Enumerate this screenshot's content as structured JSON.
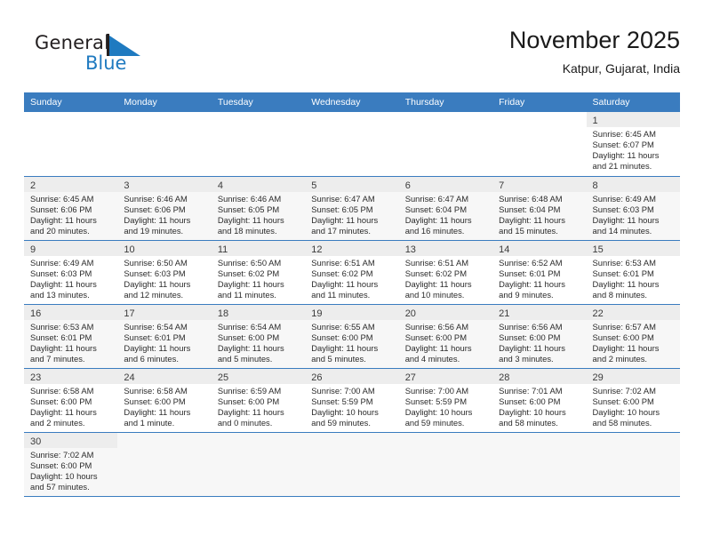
{
  "logo": {
    "word_dark": "General",
    "word_blue": "Blue",
    "flag_icon": "blue-triangle-flag-icon",
    "blue": "#1f7ac0"
  },
  "header": {
    "title": "November 2025",
    "subtitle": "Katpur, Gujarat, India"
  },
  "calendar": {
    "accent": "#3a7cbf",
    "weekdays": [
      "Sunday",
      "Monday",
      "Tuesday",
      "Wednesday",
      "Thursday",
      "Friday",
      "Saturday"
    ],
    "weeks": [
      [
        {
          "day": "",
          "lines": []
        },
        {
          "day": "",
          "lines": []
        },
        {
          "day": "",
          "lines": []
        },
        {
          "day": "",
          "lines": []
        },
        {
          "day": "",
          "lines": []
        },
        {
          "day": "",
          "lines": []
        },
        {
          "day": "1",
          "lines": [
            "Sunrise: 6:45 AM",
            "Sunset: 6:07 PM",
            "Daylight: 11 hours",
            "and 21 minutes."
          ]
        }
      ],
      [
        {
          "day": "2",
          "lines": [
            "Sunrise: 6:45 AM",
            "Sunset: 6:06 PM",
            "Daylight: 11 hours",
            "and 20 minutes."
          ]
        },
        {
          "day": "3",
          "lines": [
            "Sunrise: 6:46 AM",
            "Sunset: 6:06 PM",
            "Daylight: 11 hours",
            "and 19 minutes."
          ]
        },
        {
          "day": "4",
          "lines": [
            "Sunrise: 6:46 AM",
            "Sunset: 6:05 PM",
            "Daylight: 11 hours",
            "and 18 minutes."
          ]
        },
        {
          "day": "5",
          "lines": [
            "Sunrise: 6:47 AM",
            "Sunset: 6:05 PM",
            "Daylight: 11 hours",
            "and 17 minutes."
          ]
        },
        {
          "day": "6",
          "lines": [
            "Sunrise: 6:47 AM",
            "Sunset: 6:04 PM",
            "Daylight: 11 hours",
            "and 16 minutes."
          ]
        },
        {
          "day": "7",
          "lines": [
            "Sunrise: 6:48 AM",
            "Sunset: 6:04 PM",
            "Daylight: 11 hours",
            "and 15 minutes."
          ]
        },
        {
          "day": "8",
          "lines": [
            "Sunrise: 6:49 AM",
            "Sunset: 6:03 PM",
            "Daylight: 11 hours",
            "and 14 minutes."
          ]
        }
      ],
      [
        {
          "day": "9",
          "lines": [
            "Sunrise: 6:49 AM",
            "Sunset: 6:03 PM",
            "Daylight: 11 hours",
            "and 13 minutes."
          ]
        },
        {
          "day": "10",
          "lines": [
            "Sunrise: 6:50 AM",
            "Sunset: 6:03 PM",
            "Daylight: 11 hours",
            "and 12 minutes."
          ]
        },
        {
          "day": "11",
          "lines": [
            "Sunrise: 6:50 AM",
            "Sunset: 6:02 PM",
            "Daylight: 11 hours",
            "and 11 minutes."
          ]
        },
        {
          "day": "12",
          "lines": [
            "Sunrise: 6:51 AM",
            "Sunset: 6:02 PM",
            "Daylight: 11 hours",
            "and 11 minutes."
          ]
        },
        {
          "day": "13",
          "lines": [
            "Sunrise: 6:51 AM",
            "Sunset: 6:02 PM",
            "Daylight: 11 hours",
            "and 10 minutes."
          ]
        },
        {
          "day": "14",
          "lines": [
            "Sunrise: 6:52 AM",
            "Sunset: 6:01 PM",
            "Daylight: 11 hours",
            "and 9 minutes."
          ]
        },
        {
          "day": "15",
          "lines": [
            "Sunrise: 6:53 AM",
            "Sunset: 6:01 PM",
            "Daylight: 11 hours",
            "and 8 minutes."
          ]
        }
      ],
      [
        {
          "day": "16",
          "lines": [
            "Sunrise: 6:53 AM",
            "Sunset: 6:01 PM",
            "Daylight: 11 hours",
            "and 7 minutes."
          ]
        },
        {
          "day": "17",
          "lines": [
            "Sunrise: 6:54 AM",
            "Sunset: 6:01 PM",
            "Daylight: 11 hours",
            "and 6 minutes."
          ]
        },
        {
          "day": "18",
          "lines": [
            "Sunrise: 6:54 AM",
            "Sunset: 6:00 PM",
            "Daylight: 11 hours",
            "and 5 minutes."
          ]
        },
        {
          "day": "19",
          "lines": [
            "Sunrise: 6:55 AM",
            "Sunset: 6:00 PM",
            "Daylight: 11 hours",
            "and 5 minutes."
          ]
        },
        {
          "day": "20",
          "lines": [
            "Sunrise: 6:56 AM",
            "Sunset: 6:00 PM",
            "Daylight: 11 hours",
            "and 4 minutes."
          ]
        },
        {
          "day": "21",
          "lines": [
            "Sunrise: 6:56 AM",
            "Sunset: 6:00 PM",
            "Daylight: 11 hours",
            "and 3 minutes."
          ]
        },
        {
          "day": "22",
          "lines": [
            "Sunrise: 6:57 AM",
            "Sunset: 6:00 PM",
            "Daylight: 11 hours",
            "and 2 minutes."
          ]
        }
      ],
      [
        {
          "day": "23",
          "lines": [
            "Sunrise: 6:58 AM",
            "Sunset: 6:00 PM",
            "Daylight: 11 hours",
            "and 2 minutes."
          ]
        },
        {
          "day": "24",
          "lines": [
            "Sunrise: 6:58 AM",
            "Sunset: 6:00 PM",
            "Daylight: 11 hours",
            "and 1 minute."
          ]
        },
        {
          "day": "25",
          "lines": [
            "Sunrise: 6:59 AM",
            "Sunset: 6:00 PM",
            "Daylight: 11 hours",
            "and 0 minutes."
          ]
        },
        {
          "day": "26",
          "lines": [
            "Sunrise: 7:00 AM",
            "Sunset: 5:59 PM",
            "Daylight: 10 hours",
            "and 59 minutes."
          ]
        },
        {
          "day": "27",
          "lines": [
            "Sunrise: 7:00 AM",
            "Sunset: 5:59 PM",
            "Daylight: 10 hours",
            "and 59 minutes."
          ]
        },
        {
          "day": "28",
          "lines": [
            "Sunrise: 7:01 AM",
            "Sunset: 6:00 PM",
            "Daylight: 10 hours",
            "and 58 minutes."
          ]
        },
        {
          "day": "29",
          "lines": [
            "Sunrise: 7:02 AM",
            "Sunset: 6:00 PM",
            "Daylight: 10 hours",
            "and 58 minutes."
          ]
        }
      ],
      [
        {
          "day": "30",
          "lines": [
            "Sunrise: 7:02 AM",
            "Sunset: 6:00 PM",
            "Daylight: 10 hours",
            "and 57 minutes."
          ]
        },
        {
          "day": "",
          "lines": []
        },
        {
          "day": "",
          "lines": []
        },
        {
          "day": "",
          "lines": []
        },
        {
          "day": "",
          "lines": []
        },
        {
          "day": "",
          "lines": []
        },
        {
          "day": "",
          "lines": []
        }
      ]
    ]
  }
}
